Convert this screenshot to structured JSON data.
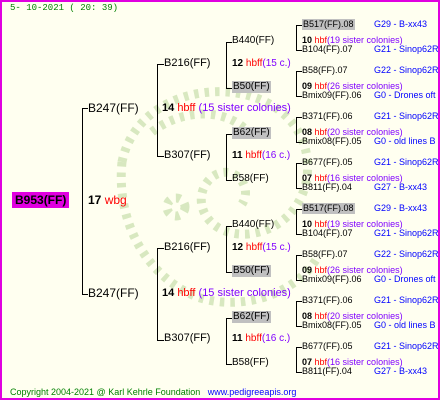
{
  "date": "5- 10-2021 ( 20: 39)",
  "root": {
    "id": "B953(FF)",
    "num": "17",
    "label": "wbg"
  },
  "gen1": [
    {
      "id": "B247(FF)",
      "num": "14",
      "hbff": "hbff",
      "sis": "(15 sister colonies)"
    },
    {
      "id": "B247(FF)",
      "num": "14",
      "hbff": "hbff",
      "sis": "(15 sister colonies)"
    }
  ],
  "gen2": [
    {
      "id": "B216(FF)",
      "num": "12",
      "hbff": "hbff",
      "sis": "(15 c.)"
    },
    {
      "id": "B307(FF)",
      "num": "11",
      "hbff": "hbff",
      "sis": "(16 c.)"
    },
    {
      "id": "B216(FF)",
      "num": "12",
      "hbff": "hbff",
      "sis": "(15 c.)"
    },
    {
      "id": "B307(FF)",
      "num": "11",
      "hbff": "hbff",
      "sis": "(16 c.)"
    }
  ],
  "gen3": [
    {
      "id": "B440(FF)",
      "num": "10",
      "hbf": "hbf",
      "sis": "(19 sister colonies)"
    },
    {
      "id": "B50(FF)",
      "num": "09",
      "hbf": "hbf",
      "sis": "(26 sister colonies)"
    },
    {
      "id": "B62(FF)",
      "num": "08",
      "hbf": "hbf",
      "sis": "(20 sister colonies)"
    },
    {
      "id": "B58(FF)",
      "num": "07",
      "hbf": "hbf",
      "sis": "(16 sister colonies)"
    },
    {
      "id": "B440(FF)",
      "num": "10",
      "hbf": "hbf",
      "sis": "(19 sister colonies)"
    },
    {
      "id": "B50(FF)",
      "num": "09",
      "hbf": "hbf",
      "sis": "(26 sister colonies)"
    },
    {
      "id": "B62(FF)",
      "num": "08",
      "hbf": "hbf",
      "sis": "(20 sister colonies)"
    },
    {
      "id": "B58(FF)",
      "num": "07",
      "hbf": "hbf",
      "sis": "(16 sister colonies)"
    }
  ],
  "gen4": [
    {
      "id": "B517(FF).08",
      "info": "G29 - B-xx43"
    },
    {
      "id": "B104(FF).07",
      "info": "G21 - Sinop62R"
    },
    {
      "id": "B58(FF).07",
      "info": "G22 - Sinop62R"
    },
    {
      "id": "Bmix09(FF).06",
      "info": "G0 - Drones oft"
    },
    {
      "id": "B371(FF).06",
      "info": "G21 - Sinop62R"
    },
    {
      "id": "Bmix08(FF).05",
      "info": "G0 - old lines B"
    },
    {
      "id": "B677(FF).05",
      "info": "G21 - Sinop62R"
    },
    {
      "id": "B811(FF).04",
      "info": "G27 - B-xx43"
    },
    {
      "id": "B517(FF).08",
      "info": "G29 - B-xx43"
    },
    {
      "id": "B104(FF).07",
      "info": "G21 - Sinop62R"
    },
    {
      "id": "B58(FF).07",
      "info": "G22 - Sinop62R"
    },
    {
      "id": "Bmix09(FF).06",
      "info": "G0 - Drones oft"
    },
    {
      "id": "B371(FF).06",
      "info": "G21 - Sinop62R"
    },
    {
      "id": "Bmix08(FF).05",
      "info": "G0 - old lines B"
    },
    {
      "id": "B677(FF).05",
      "info": "G21 - Sinop62R"
    },
    {
      "id": "B811(FF).04",
      "info": "G27 - B-xx43"
    }
  ],
  "footer": {
    "copyright": "Copyright 2004-2021 @ Karl Kehrle Foundation",
    "site": "www.pedigreeapis.org"
  }
}
